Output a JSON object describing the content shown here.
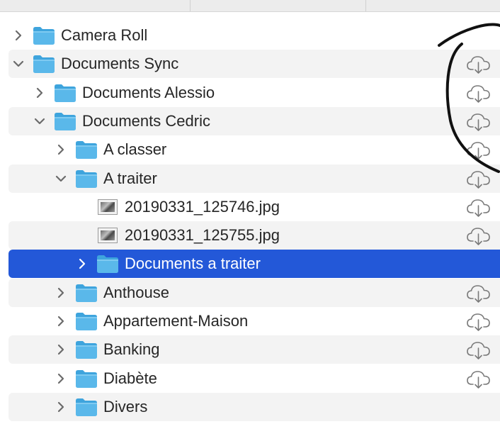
{
  "colors": {
    "folder": "#5ab8ea",
    "folder_tab": "#3ea4dd",
    "selection": "#2358d8",
    "alt_row": "#f3f3f3",
    "text": "#262626"
  },
  "rows": [
    {
      "label": "Camera Roll",
      "level": 0,
      "kind": "folder",
      "expanded": false,
      "icon": "folder-icon",
      "cloud": false
    },
    {
      "label": "Documents Sync",
      "level": 0,
      "kind": "folder",
      "expanded": true,
      "icon": "folder-icon",
      "cloud": true
    },
    {
      "label": "Documents Alessio",
      "level": 1,
      "kind": "folder",
      "expanded": false,
      "icon": "folder-icon",
      "cloud": true
    },
    {
      "label": "Documents Cedric",
      "level": 1,
      "kind": "folder",
      "expanded": true,
      "icon": "folder-icon",
      "cloud": true
    },
    {
      "label": "A classer",
      "level": 2,
      "kind": "folder",
      "expanded": false,
      "icon": "folder-icon",
      "cloud": true
    },
    {
      "label": "A traiter",
      "level": 2,
      "kind": "folder",
      "expanded": true,
      "icon": "folder-icon",
      "cloud": true
    },
    {
      "label": "20190331_125746.jpg",
      "level": 3,
      "kind": "file",
      "icon": "image-file-icon",
      "cloud": true
    },
    {
      "label": "20190331_125755.jpg",
      "level": 3,
      "kind": "file",
      "icon": "image-file-icon",
      "cloud": true
    },
    {
      "label": "Documents a traiter",
      "level": 3,
      "kind": "folder",
      "expanded": false,
      "selected": true,
      "icon": "folder-icon",
      "cloud": false
    },
    {
      "label": "Anthouse",
      "level": 2,
      "kind": "folder",
      "expanded": false,
      "icon": "folder-icon",
      "cloud": true
    },
    {
      "label": "Appartement-Maison",
      "level": 2,
      "kind": "folder",
      "expanded": false,
      "icon": "folder-icon",
      "cloud": true
    },
    {
      "label": "Banking",
      "level": 2,
      "kind": "folder",
      "expanded": false,
      "icon": "folder-icon",
      "cloud": true
    },
    {
      "label": "Diabète",
      "level": 2,
      "kind": "folder",
      "expanded": false,
      "icon": "folder-icon",
      "cloud": true
    },
    {
      "label": "Divers",
      "level": 2,
      "kind": "folder",
      "expanded": false,
      "icon": "folder-icon",
      "cloud": false
    }
  ]
}
